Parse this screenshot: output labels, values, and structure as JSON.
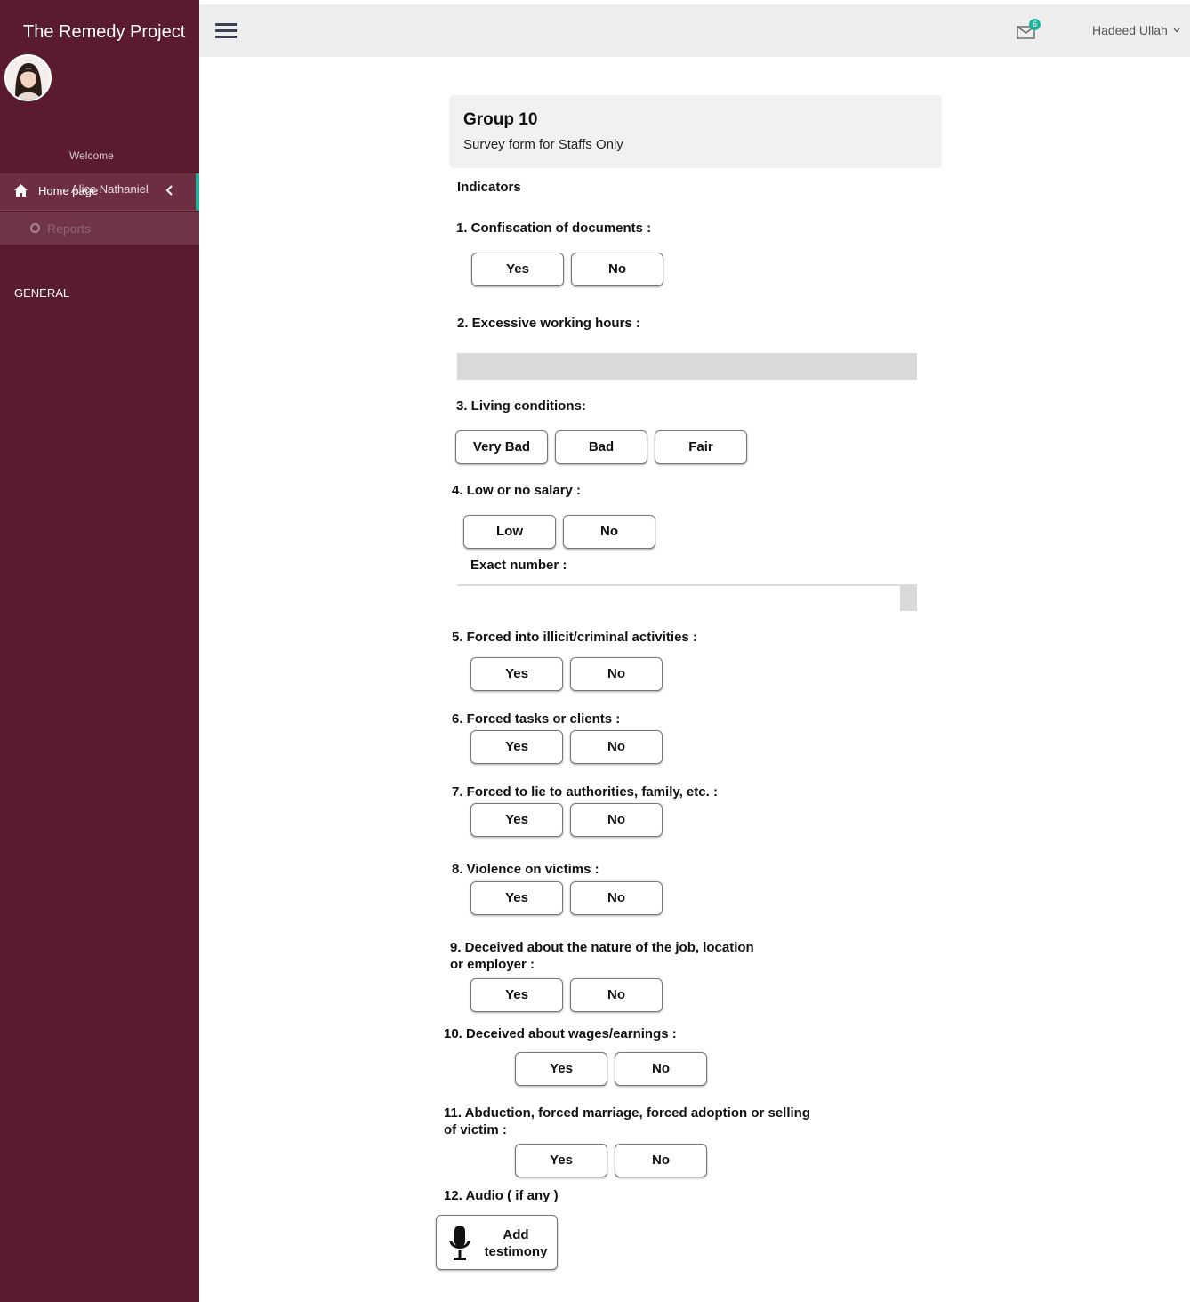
{
  "sidebar": {
    "brand": "The Remedy Project",
    "welcome": "Welcome",
    "user_name": "Alice Nathaniel",
    "nav_home": "Home page",
    "nav_reports": "Reports",
    "section_general": "GENERAL"
  },
  "topbar": {
    "mail_count": "6",
    "user_menu": "Hadeed Ullah"
  },
  "form": {
    "group_title": "Group 10",
    "subtitle": "Survey form for Staffs Only",
    "indicators_heading": "Indicators",
    "q1": {
      "label": "1. Confiscation of documents :",
      "options": [
        "Yes",
        "No"
      ]
    },
    "q2": {
      "label": "2. Excessive working hours :",
      "value": ""
    },
    "q3": {
      "label": "3. Living conditions:",
      "options": [
        "Very Bad",
        "Bad",
        "Fair"
      ]
    },
    "q4": {
      "label": "4. Low or no salary :",
      "options": [
        "Low",
        "No"
      ],
      "exact_label": "Exact number :",
      "exact_value": ""
    },
    "q5": {
      "label": "5. Forced into illicit/criminal activities  :",
      "options": [
        "Yes",
        "No"
      ]
    },
    "q6": {
      "label": "6. Forced tasks or clients :",
      "options": [
        "Yes",
        "No"
      ]
    },
    "q7": {
      "label": "7. Forced to lie to authorities, family, etc.  :",
      "options": [
        "Yes",
        "No"
      ]
    },
    "q8": {
      "label": "8. Violence on victims  :",
      "options": [
        "Yes",
        "No"
      ]
    },
    "q9": {
      "label_line1": "9. Deceived about the nature of the job, location",
      "label_line2": "or employer :",
      "options": [
        "Yes",
        "No"
      ]
    },
    "q10": {
      "label": "10. Deceived about wages/earnings :",
      "options": [
        "Yes",
        "No"
      ]
    },
    "q11": {
      "label_line1": "11. Abduction, forced marriage, forced adoption or selling",
      "label_line2": "of victim :",
      "options": [
        "Yes",
        "No"
      ]
    },
    "q12": {
      "label": "12.  Audio ( if any )",
      "button_line1": "Add",
      "button_line2": "testimony"
    }
  },
  "colors": {
    "sidebar_bg": "#5a1b2e",
    "accent": "#1fb39a",
    "topbar_bg": "#eeeeee"
  },
  "icons": [
    "home-icon",
    "chevron-left-icon",
    "circle-icon",
    "hamburger-icon",
    "mail-icon",
    "chevron-down-icon",
    "microphone-icon"
  ]
}
